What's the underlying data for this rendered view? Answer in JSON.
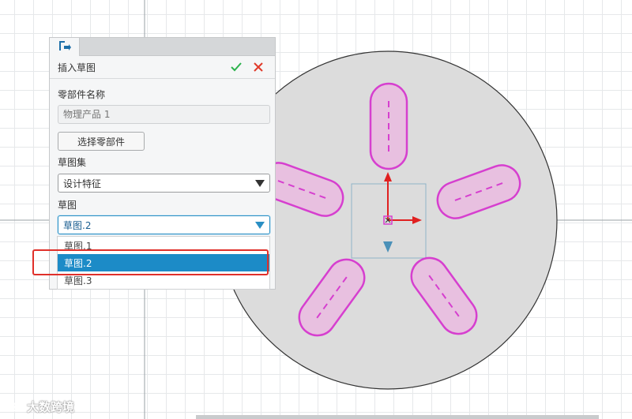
{
  "panel": {
    "title": "插入草图",
    "part_name_label": "零部件名称",
    "part_name_placeholder": "物理产品 1",
    "select_part_button": "选择零部件",
    "sketch_set_label": "草图集",
    "sketch_set_value": "设计特征",
    "sketch_label": "草图",
    "sketch_value": "草图.2"
  },
  "dropdown": {
    "options": [
      "草图.1",
      "草图.2",
      "草图.3"
    ],
    "selected": "草图.2"
  },
  "watermark": {
    "text": "大数跨境"
  },
  "colors": {
    "accent": "#1c8bc7",
    "highlight": "#e0302a",
    "confirm": "#2bb24c",
    "cancel": "#e03a2a",
    "sketch_stroke": "#d63fcf",
    "sketch_fill": "#e8c0e0",
    "disk_fill": "#dcdcdc"
  },
  "icons": {
    "panel_tab": "insert-sketch-icon",
    "confirm": "check-icon",
    "cancel": "close-icon",
    "dropdown": "triangle-down-icon"
  }
}
